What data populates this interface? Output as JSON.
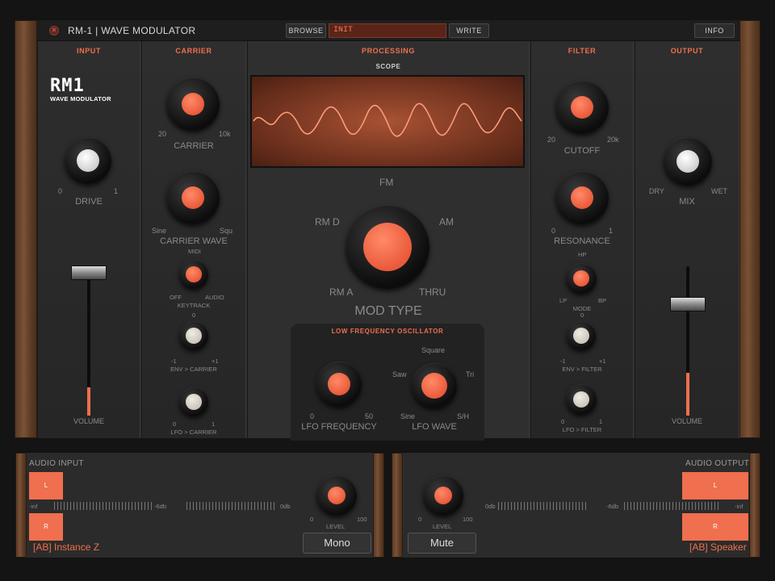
{
  "window": {
    "title": "RM-1 | WAVE MODULATOR",
    "browse_label": "BROWSE",
    "preset_name": "INIT",
    "write_label": "WRITE",
    "info_label": "INFO"
  },
  "sections": {
    "input": "INPUT",
    "carrier": "CARRIER",
    "processing": "PROCESSING",
    "scope": "SCOPE",
    "filter": "FILTER",
    "output": "OUTPUT"
  },
  "logo": {
    "main": "RM1",
    "sub": "WAVE MODULATOR"
  },
  "input": {
    "drive": {
      "label": "DRIVE",
      "min": "0",
      "max": "1",
      "value": 0.5
    },
    "volume": {
      "label": "VOLUME",
      "level": 0.2
    }
  },
  "carrier": {
    "carrier": {
      "label": "CARRIER",
      "min": "20",
      "max": "10k",
      "value": 0.5
    },
    "carrier_wave": {
      "label": "CARRIER WAVE",
      "min": "Sine",
      "max": "Squ"
    },
    "keytrack": {
      "label": "KEYTRACK",
      "top": "MIDI",
      "left": "OFF",
      "right": "AUDIO"
    },
    "env_carrier": {
      "label": "ENV > CARRIER",
      "top": "0",
      "min": "-1",
      "max": "+1"
    },
    "lfo_carrier": {
      "label": "LFO > CARRIER",
      "min": "0",
      "max": "1"
    }
  },
  "processing": {
    "mod_type": {
      "label": "MOD TYPE",
      "options": [
        "FM",
        "AM",
        "THRU",
        "RM A",
        "RM D"
      ],
      "selected": "RM D"
    },
    "lfo": {
      "title": "LOW FREQUENCY OSCILLATOR",
      "frequency": {
        "label": "LFO FREQUENCY",
        "min": "0",
        "max": "50"
      },
      "wave": {
        "label": "LFO WAVE",
        "options": [
          "Square",
          "Tri",
          "S/H",
          "Sine",
          "Saw"
        ],
        "selected": "Square"
      }
    }
  },
  "filter": {
    "cutoff": {
      "label": "CUTOFF",
      "min": "20",
      "max": "20k"
    },
    "resonance": {
      "label": "RESONANCE",
      "min": "0",
      "max": "1"
    },
    "mode": {
      "label": "MODE",
      "top": "HP",
      "left": "LP",
      "right": "BP"
    },
    "env_filter": {
      "label": "ENV > FILTER",
      "top": "0",
      "min": "-1",
      "max": "+1"
    },
    "lfo_filter": {
      "label": "LFO > FILTER",
      "min": "0",
      "max": "1"
    }
  },
  "output": {
    "mix": {
      "label": "MIX",
      "min": "DRY",
      "max": "WET"
    },
    "volume": {
      "label": "VOLUME",
      "level": 0.35
    }
  },
  "audio_input": {
    "title": "AUDIO INPUT",
    "left": "L",
    "right": "R",
    "scale": [
      "-inf",
      "-6db",
      "0db"
    ],
    "level_label": "LEVEL",
    "level_min": "0",
    "level_max": "100",
    "mode_button": "Mono",
    "source": "[AB] Instance Z"
  },
  "audio_output": {
    "title": "AUDIO OUTPUT",
    "left": "L",
    "right": "R",
    "scale": [
      "0db",
      "-6db",
      "-inf"
    ],
    "level_label": "LEVEL",
    "level_min": "0",
    "level_max": "100",
    "mute_button": "Mute",
    "destination": "[AB] Speaker"
  },
  "colors": {
    "accent": "#ef6f4e",
    "panel": "#2b2b2b",
    "background": "#141414"
  }
}
